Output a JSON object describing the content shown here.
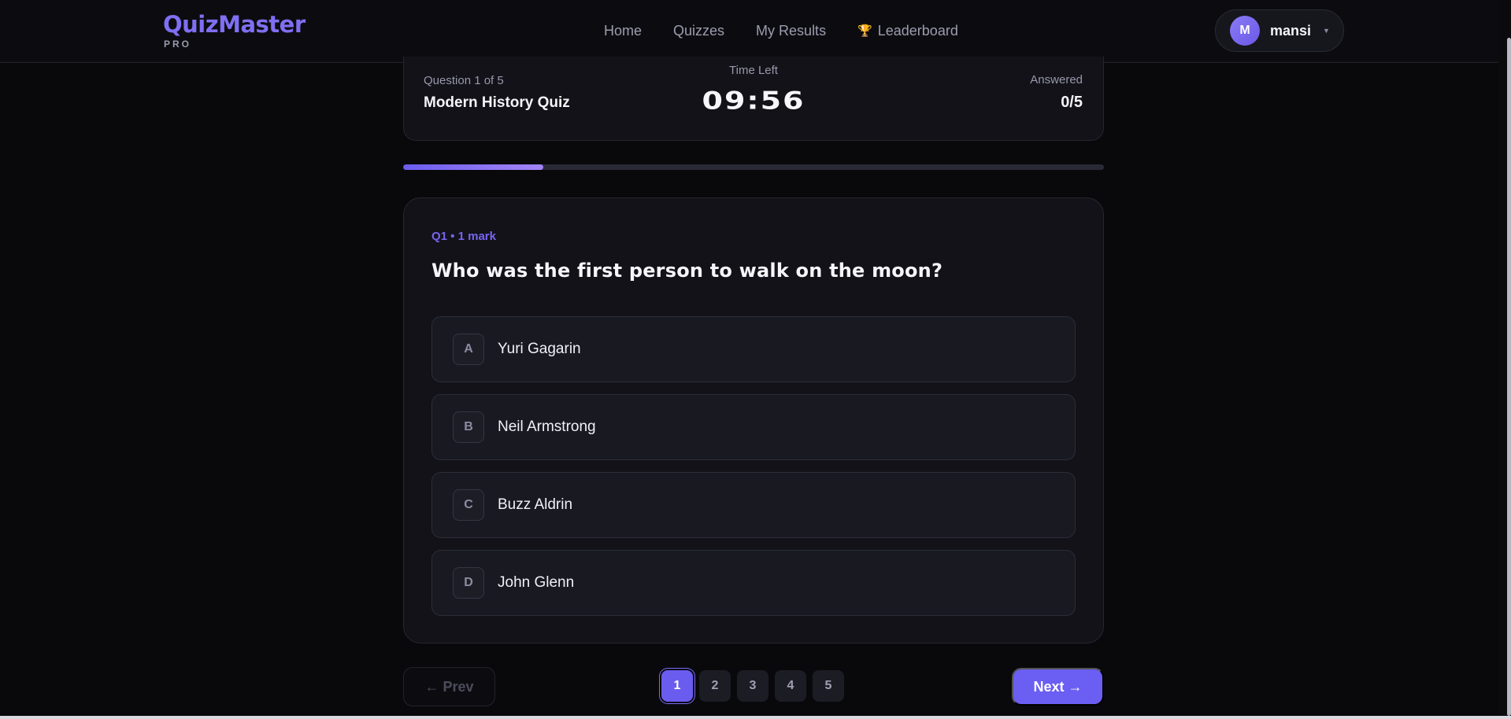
{
  "navbar": {
    "logo_title": "QuizMaster",
    "logo_sub": "PRO",
    "links": [
      {
        "label": "Home"
      },
      {
        "label": "Quizzes"
      },
      {
        "label": "My Results"
      },
      {
        "label": "Leaderboard",
        "icon": "trophy-icon"
      }
    ],
    "user": {
      "initial": "M",
      "name": "mansi"
    }
  },
  "quiz": {
    "question_count": "Question 1 of 5",
    "title": "Modern History Quiz",
    "time_label": "Time Left",
    "timer": "09:56",
    "answered_label": "Answered",
    "answered_value": "0/5",
    "progress_fraction": 0.2
  },
  "question": {
    "meta": "Q1 • 1 mark",
    "text": "Who was the first person to walk on the moon?",
    "options": [
      {
        "letter": "A",
        "text": "Yuri Gagarin"
      },
      {
        "letter": "B",
        "text": "Neil Armstrong"
      },
      {
        "letter": "C",
        "text": "Buzz Aldrin"
      },
      {
        "letter": "D",
        "text": "John Glenn"
      }
    ]
  },
  "footer": {
    "prev_label": "← Prev",
    "next_label": "Next →",
    "pages": [
      "1",
      "2",
      "3",
      "4",
      "5"
    ],
    "active_page": "1"
  },
  "colors": {
    "accent": "#6b5ef2",
    "background": "#09090c",
    "card": "#121218"
  }
}
